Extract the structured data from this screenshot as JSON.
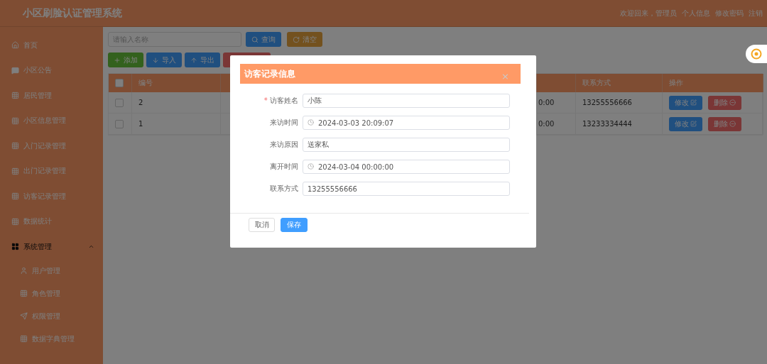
{
  "header": {
    "title": "小区刷脸认证管理系统",
    "welcome": "欢迎回来，管理员",
    "links": [
      "个人信息",
      "修改密码",
      "注销"
    ]
  },
  "sidebar": {
    "items": [
      {
        "label": "首页",
        "kind": "home"
      },
      {
        "label": "小区公告",
        "kind": "chat"
      },
      {
        "label": "居民管理",
        "kind": "grid"
      },
      {
        "label": "小区信息管理",
        "kind": "grid"
      },
      {
        "label": "入门记录管理",
        "kind": "grid"
      },
      {
        "label": "出门记录管理",
        "kind": "grid"
      },
      {
        "label": "访客记录管理",
        "kind": "grid"
      },
      {
        "label": "数据统计",
        "kind": "grid"
      },
      {
        "label": "系统管理",
        "kind": "group",
        "expanded": true,
        "children": [
          {
            "label": "用户管理",
            "kind": "user"
          },
          {
            "label": "角色管理",
            "kind": "grid"
          },
          {
            "label": "权限管理",
            "kind": "send"
          },
          {
            "label": "数据字典管理",
            "kind": "grid"
          }
        ]
      }
    ]
  },
  "toolbar": {
    "search": {
      "placeholder": "请输入名称"
    },
    "buttons": [
      {
        "label": "查询",
        "kind": "search"
      },
      {
        "label": "清空",
        "kind": "reset"
      }
    ]
  },
  "actions": [
    {
      "label": "添加",
      "kind": "add"
    },
    {
      "label": "导入",
      "kind": "import"
    },
    {
      "label": "导出",
      "kind": "export"
    },
    {
      "kind": "danger"
    }
  ],
  "table": {
    "header_checked": false,
    "columns": [
      {
        "label": "编号"
      },
      {
        "label": "联系方式"
      },
      {
        "label": "操作"
      }
    ],
    "rows": [
      {
        "checked": false,
        "id": "2",
        "column_4": "0:00",
        "phone": "13255556666",
        "buttons": [
          {
            "label": "修改",
            "kind": "edit"
          },
          {
            "label": "删除",
            "kind": "delete"
          }
        ]
      },
      {
        "checked": false,
        "id": "1",
        "column_4": "0:00",
        "phone": "13233334444",
        "buttons": [
          {
            "label": "修改",
            "kind": "edit"
          },
          {
            "label": "删除",
            "kind": "delete"
          }
        ]
      }
    ]
  },
  "dialog": {
    "title": "访客记录信息",
    "close": "×",
    "required_mark": "*",
    "fields": [
      {
        "label": "访客姓名",
        "required": true,
        "kind": "text",
        "value": "小陈"
      },
      {
        "label": "来访时间",
        "required": false,
        "kind": "datetime",
        "value": "2024-03-03 20:09:07"
      },
      {
        "label": "来访原因",
        "required": false,
        "kind": "text",
        "value": "送家私"
      },
      {
        "label": "离开时间",
        "required": false,
        "kind": "datetime",
        "value": "2024-03-04 00:00:00"
      },
      {
        "label": "联系方式",
        "required": false,
        "kind": "text",
        "value": "13255556666"
      }
    ],
    "buttons": [
      {
        "label": "取消",
        "kind": "default"
      },
      {
        "label": "保存",
        "kind": "primary"
      }
    ]
  }
}
